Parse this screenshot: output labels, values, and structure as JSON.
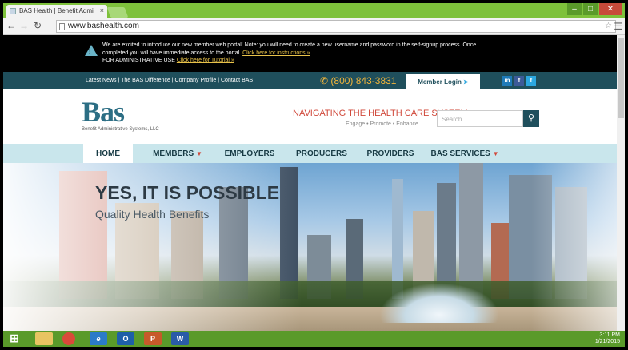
{
  "browser": {
    "tab_title": "BAS Health | Benefit Admi",
    "tab_close": "×",
    "url": "www.bashealth.com"
  },
  "notice": {
    "line1": "We are excited to introduce our new member web portal! Note: you will need to create a new username and password in the self-signup process. Once",
    "line2_prefix": "completed you will have immediate access to the portal.",
    "instructions_link": "Click here for instructions »",
    "line3_prefix": "FOR ADMINISTRATIVE USE",
    "tutorial_link": "Click here for Tutorial »"
  },
  "topbar": {
    "links": "Latest News  |  The BAS Difference  |  Company Profile  |  Contact BAS",
    "phone": "(800) 843-3831",
    "login": "Member Login"
  },
  "header": {
    "logo": "Bas",
    "logo_sub": "Benefit Administrative Systems, LLC",
    "tagline": "NAVIGATING THE HEALTH CARE SYSTEM",
    "tagline_sub": "Engage • Promote • Enhance",
    "search_placeholder": "Search"
  },
  "nav": {
    "home": "HOME",
    "members": "MEMBERS",
    "employers": "EMPLOYERS",
    "producers": "PRODUCERS",
    "providers": "PROVIDERS",
    "services": "BAS SERVICES"
  },
  "hero": {
    "title": "YES, IT IS POSSIBLE",
    "subtitle": "Quality Health Benefits"
  },
  "taskbar": {
    "time": "3:11 PM",
    "date": "1/21/2015"
  }
}
